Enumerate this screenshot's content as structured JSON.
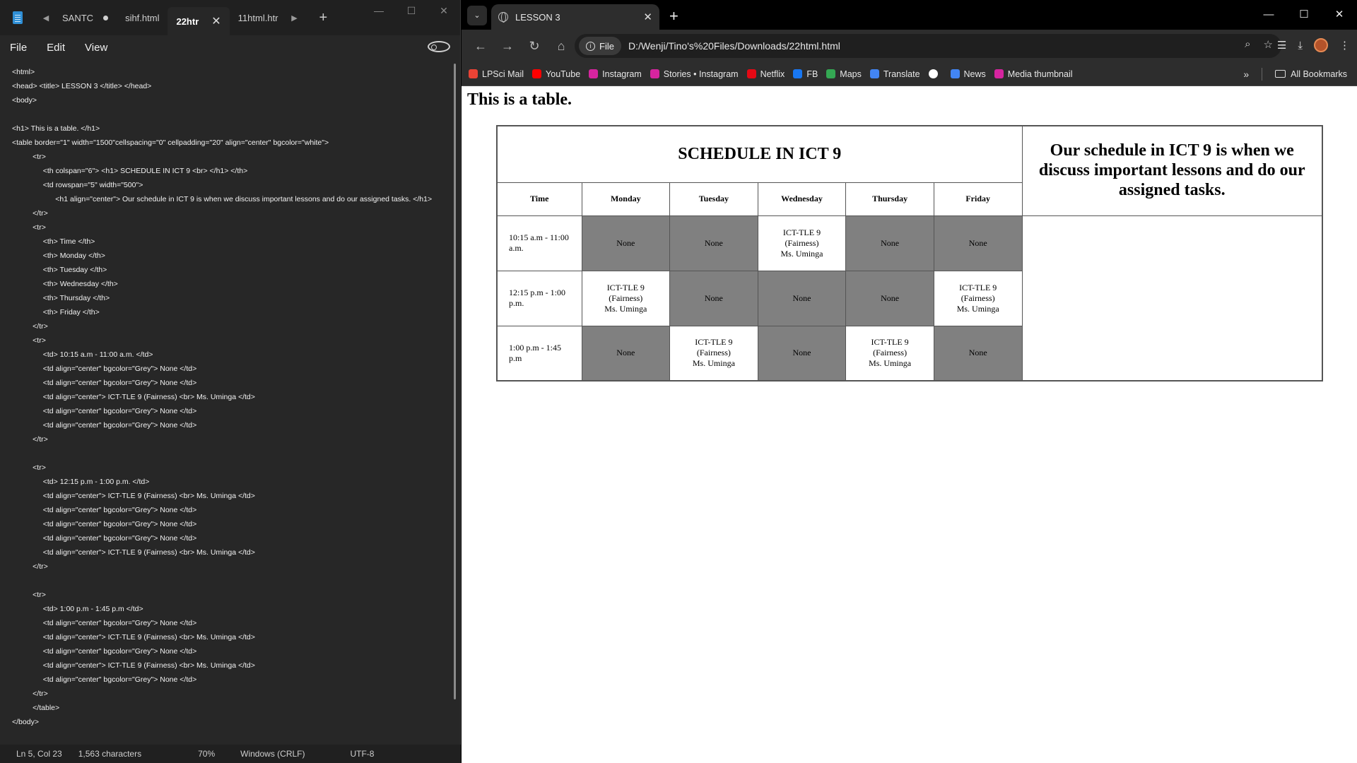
{
  "notepad": {
    "tabs": [
      {
        "label": "SANTC",
        "modified": true
      },
      {
        "label": "sihf.html"
      },
      {
        "label": "22htr",
        "active": true
      },
      {
        "label": "11html.htr"
      }
    ],
    "menu": [
      "File",
      "Edit",
      "View"
    ],
    "code_lines": [
      "<html>",
      "<head> <title> LESSON 3 </title> </head>",
      "<body>",
      "",
      "<h1> This is a table. </h1>",
      "<table border=\"1\" width=\"1500\"cellspacing=\"0\" cellpadding=\"20\" align=\"center\" bgcolor=\"white\">",
      "          <tr>",
      "               <th colspan=\"6\"> <h1> SCHEDULE IN ICT 9 <br> </h1> </th>",
      "               <td rowspan=\"5\" width=\"500\">",
      "                     <h1 align=\"center\"> Our schedule in ICT 9 is when we discuss important lessons and do our assigned tasks. </h1>",
      "          </tr>",
      "          <tr>",
      "               <th> Time </th>",
      "               <th> Monday </th>",
      "               <th> Tuesday </th>",
      "               <th> Wednesday </th>",
      "               <th> Thursday </th>",
      "               <th> Friday </th>",
      "          </tr>",
      "          <tr>",
      "               <td> 10:15 a.m - 11:00 a.m. </td>",
      "               <td align=\"center\" bgcolor=\"Grey\"> None </td>",
      "               <td align=\"center\" bgcolor=\"Grey\"> None </td>",
      "               <td align=\"center\"> ICT-TLE 9 (Fairness) <br> Ms. Uminga </td>",
      "               <td align=\"center\" bgcolor=\"Grey\"> None </td>",
      "               <td align=\"center\" bgcolor=\"Grey\"> None </td>",
      "          </tr>",
      "",
      "          <tr>",
      "               <td> 12:15 p.m - 1:00 p.m. </td>",
      "               <td align=\"center\"> ICT-TLE 9 (Fairness) <br> Ms. Uminga </td>",
      "               <td align=\"center\" bgcolor=\"Grey\"> None </td>",
      "               <td align=\"center\" bgcolor=\"Grey\"> None </td>",
      "               <td align=\"center\" bgcolor=\"Grey\"> None </td>",
      "               <td align=\"center\"> ICT-TLE 9 (Fairness) <br> Ms. Uminga </td>",
      "          </tr>",
      "",
      "          <tr>",
      "               <td> 1:00 p.m - 1:45 p.m </td>",
      "               <td align=\"center\" bgcolor=\"Grey\"> None </td>",
      "               <td align=\"center\"> ICT-TLE 9 (Fairness) <br> Ms. Uminga </td>",
      "               <td align=\"center\" bgcolor=\"Grey\"> None </td>",
      "               <td align=\"center\"> ICT-TLE 9 (Fairness) <br> Ms. Uminga </td>",
      "               <td align=\"center\" bgcolor=\"Grey\"> None </td>",
      "          </tr>",
      "          </table>",
      "</body>"
    ],
    "status": {
      "position": "Ln 5, Col 23",
      "characters": "1,563 characters",
      "zoom": "70%",
      "line_ending": "Windows (CRLF)",
      "encoding": "UTF-8"
    }
  },
  "browser": {
    "tab_title": "LESSON 3",
    "file_chip": "File",
    "url": "D:/Wenji/Tino's%20Files/Downloads/22html.html",
    "bookmarks": [
      {
        "label": "LPSci Mail",
        "color": "#ea4335"
      },
      {
        "label": "YouTube",
        "color": "#ff0000"
      },
      {
        "label": "Instagram",
        "color": "#d6249f"
      },
      {
        "label": "Stories • Instagram",
        "color": "#d6249f"
      },
      {
        "label": "Netflix",
        "color": "#e50914"
      },
      {
        "label": "FB",
        "color": "#1877f2"
      },
      {
        "label": "Maps",
        "color": "#34a853"
      },
      {
        "label": "Translate",
        "color": "#4285f4"
      },
      {
        "label": "",
        "color": "#ffffff"
      },
      {
        "label": "News",
        "color": "#4285f4"
      },
      {
        "label": "Media thumbnail",
        "color": "#d6249f"
      }
    ],
    "all_bookmarks": "All Bookmarks"
  },
  "page": {
    "heading": "This is a table.",
    "table_title": "SCHEDULE IN ICT 9",
    "side_text": "Our schedule in ICT 9 is when we discuss important lessons and do our assigned tasks.",
    "headers": [
      "Time",
      "Monday",
      "Tuesday",
      "Wednesday",
      "Thursday",
      "Friday"
    ],
    "rows": [
      {
        "time": "10:15 a.m - 11:00 a.m.",
        "cells": [
          {
            "grey": true,
            "lines": [
              "None"
            ]
          },
          {
            "grey": true,
            "lines": [
              "None"
            ]
          },
          {
            "grey": false,
            "lines": [
              "ICT-TLE 9",
              "(Fairness)",
              "Ms. Uminga"
            ]
          },
          {
            "grey": true,
            "lines": [
              "None"
            ]
          },
          {
            "grey": true,
            "lines": [
              "None"
            ]
          }
        ]
      },
      {
        "time": "12:15 p.m - 1:00 p.m.",
        "cells": [
          {
            "grey": false,
            "lines": [
              "ICT-TLE 9",
              "(Fairness)",
              "Ms. Uminga"
            ]
          },
          {
            "grey": true,
            "lines": [
              "None"
            ]
          },
          {
            "grey": true,
            "lines": [
              "None"
            ]
          },
          {
            "grey": true,
            "lines": [
              "None"
            ]
          },
          {
            "grey": false,
            "lines": [
              "ICT-TLE 9",
              "(Fairness)",
              "Ms. Uminga"
            ]
          }
        ]
      },
      {
        "time": "1:00 p.m - 1:45 p.m",
        "cells": [
          {
            "grey": true,
            "lines": [
              "None"
            ]
          },
          {
            "grey": false,
            "lines": [
              "ICT-TLE 9",
              "(Fairness)",
              "Ms. Uminga"
            ]
          },
          {
            "grey": true,
            "lines": [
              "None"
            ]
          },
          {
            "grey": false,
            "lines": [
              "ICT-TLE 9",
              "(Fairness)",
              "Ms. Uminga"
            ]
          },
          {
            "grey": true,
            "lines": [
              "None"
            ]
          }
        ]
      }
    ]
  }
}
